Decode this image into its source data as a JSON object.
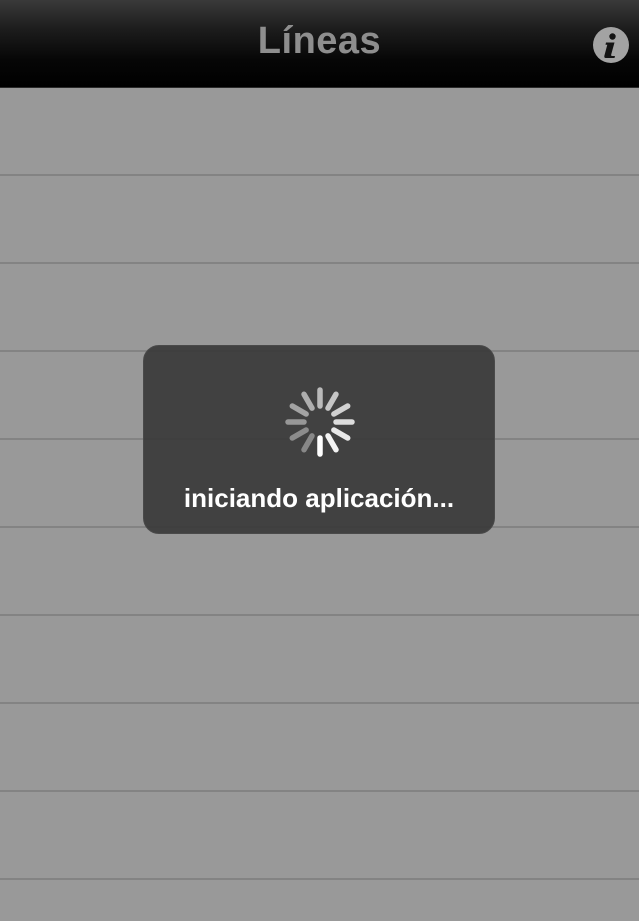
{
  "nav": {
    "title": "Líneas",
    "info_icon": "info-icon"
  },
  "list": {
    "row_count": 9
  },
  "loading": {
    "message": "iniciando aplicación...",
    "spinner_icon": "activity-spinner-icon"
  },
  "colors": {
    "background": "#999999",
    "navbar": "#000000",
    "title": "#8e8e8e",
    "hud": "#3a3a3a",
    "hud_text": "#ffffff"
  }
}
